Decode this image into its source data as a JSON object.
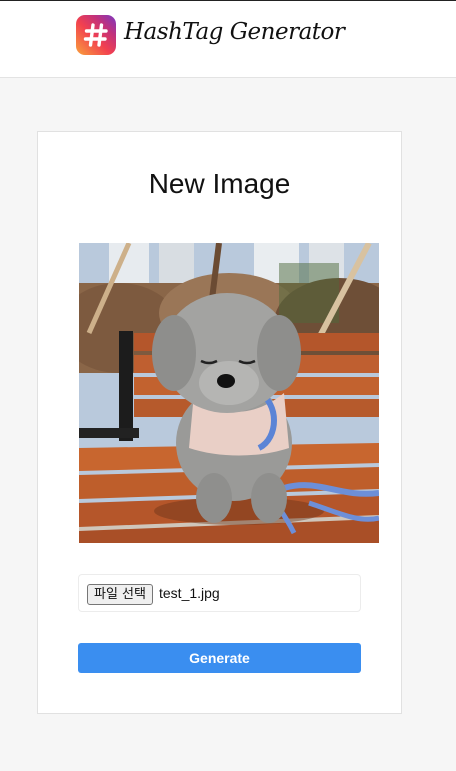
{
  "header": {
    "brand": "HashTag Generator",
    "logo_icon": "hashtag-icon"
  },
  "card": {
    "title": "New Image",
    "image_alt": "poodle-on-bench-photo",
    "file_input": {
      "button_label": "파일 선택",
      "file_name": "test_1.jpg"
    },
    "generate_label": "Generate"
  },
  "colors": {
    "page_bg": "#f6f6f6",
    "button_blue": "#3a8ef0"
  }
}
